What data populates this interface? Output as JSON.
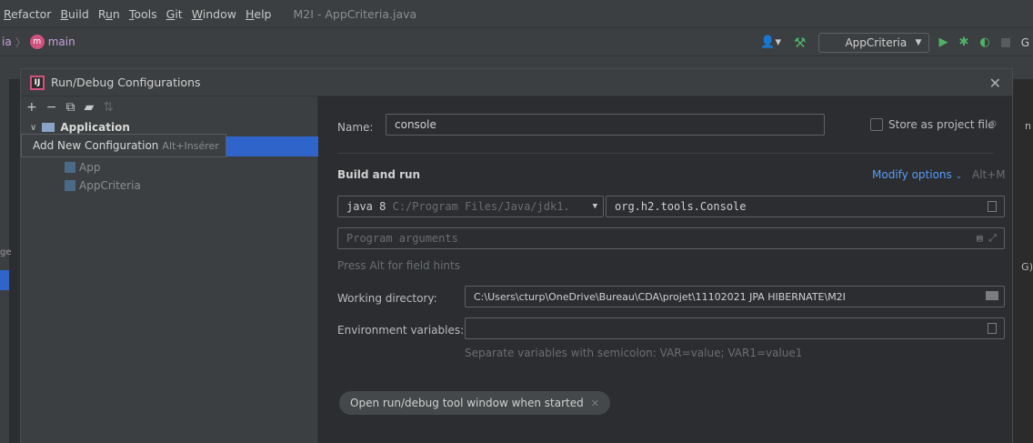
{
  "menubar": {
    "items": [
      {
        "pre": "",
        "mn": "R",
        "post": "efactor"
      },
      {
        "pre": "",
        "mn": "B",
        "post": "uild"
      },
      {
        "pre": "R",
        "mn": "u",
        "post": "n"
      },
      {
        "pre": "",
        "mn": "T",
        "post": "ools"
      },
      {
        "pre": "",
        "mn": "G",
        "post": "it"
      },
      {
        "pre": "",
        "mn": "W",
        "post": "indow"
      },
      {
        "pre": "",
        "mn": "H",
        "post": "elp"
      }
    ],
    "window_title": "M2I - AppCriteria.java"
  },
  "navbar": {
    "crumb_fragment": "ia",
    "branch": "main",
    "run_config": "AppCriteria",
    "right_letter": "G"
  },
  "dialog": {
    "title": "Run/Debug Configurations",
    "tree": {
      "group": "Application",
      "items": [
        "App",
        "AppCriteria"
      ]
    },
    "tooltip": {
      "label": "Add New Configuration",
      "shortcut": "Alt+Insérer"
    },
    "form": {
      "name_label": "Name:",
      "name_value": "console",
      "store_label": "Store as project file",
      "section_title": "Build and run",
      "modify_options": "Modify options",
      "modify_shortcut": "Alt+M",
      "jdk_prefix": "java 8",
      "jdk_path": "C:/Program Files/Java/jdk1.",
      "main_class": "org.h2.tools.Console",
      "program_args_placeholder": "Program arguments",
      "field_hint": "Press Alt for field hints",
      "workdir_label": "Working directory:",
      "workdir_value": "C:\\Users\\cturp\\OneDrive\\Bureau\\CDA\\projet\\11102021 JPA HIBERNATE\\M2I",
      "env_label": "Environment variables:",
      "env_hint": "Separate variables with semicolon: VAR=value; VAR1=value1",
      "chip_label": "Open run/debug tool window when started"
    }
  },
  "ide_edge": {
    "left_text": "ge",
    "right_text_1": "n",
    "right_text_2": "G)"
  },
  "colors": {
    "accent": "#2f65ca",
    "link": "#589df6",
    "run_green": "#4eb366",
    "brand_pink": "#d2527f"
  }
}
